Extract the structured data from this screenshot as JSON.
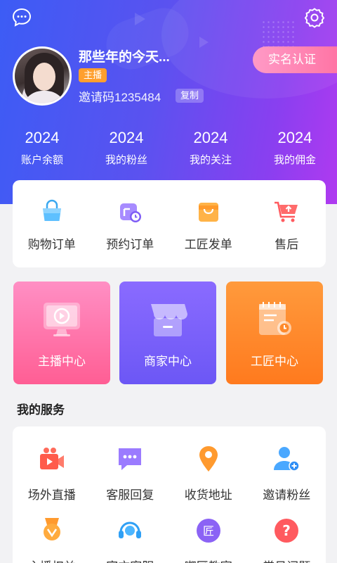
{
  "header": {
    "username": "那些年的今天...",
    "role_badge": "主播",
    "invite_code": "邀请码1235484",
    "copy_label": "复制",
    "verify_label": "实名认证",
    "icons": {
      "message": "chat-bubble-icon",
      "settings": "gear-icon"
    }
  },
  "stats": [
    {
      "value": "2024",
      "label": "账户余额"
    },
    {
      "value": "2024",
      "label": "我的粉丝"
    },
    {
      "value": "2024",
      "label": "我的关注"
    },
    {
      "value": "2024",
      "label": "我的佣金"
    }
  ],
  "orders": [
    {
      "label": "购物订单",
      "icon": "shopping-bag-icon"
    },
    {
      "label": "预约订单",
      "icon": "calendar-clock-icon"
    },
    {
      "label": "工匠发单",
      "icon": "bag-icon"
    },
    {
      "label": "售后",
      "icon": "cart-upload-icon"
    }
  ],
  "tiles": [
    {
      "label": "主播中心",
      "icon": "monitor-play-icon",
      "color": "#ff6fa5"
    },
    {
      "label": "商家中心",
      "icon": "store-icon",
      "color": "#7a60fa"
    },
    {
      "label": "工匠中心",
      "icon": "notepad-clock-icon",
      "color": "#ff8a2b"
    }
  ],
  "services_title": "我的服务",
  "services": [
    {
      "label": "场外直播",
      "icon": "video-camera-icon"
    },
    {
      "label": "客服回复",
      "icon": "chat-dots-icon"
    },
    {
      "label": "收货地址",
      "icon": "location-pin-icon"
    },
    {
      "label": "邀请粉丝",
      "icon": "add-user-icon"
    },
    {
      "label": "主播权益",
      "icon": "medal-icon"
    },
    {
      "label": "官方客服",
      "icon": "headset-icon"
    },
    {
      "label": "嘟匠教室",
      "icon": "badge-jiang-icon"
    },
    {
      "label": "常见问题",
      "icon": "question-icon"
    }
  ]
}
